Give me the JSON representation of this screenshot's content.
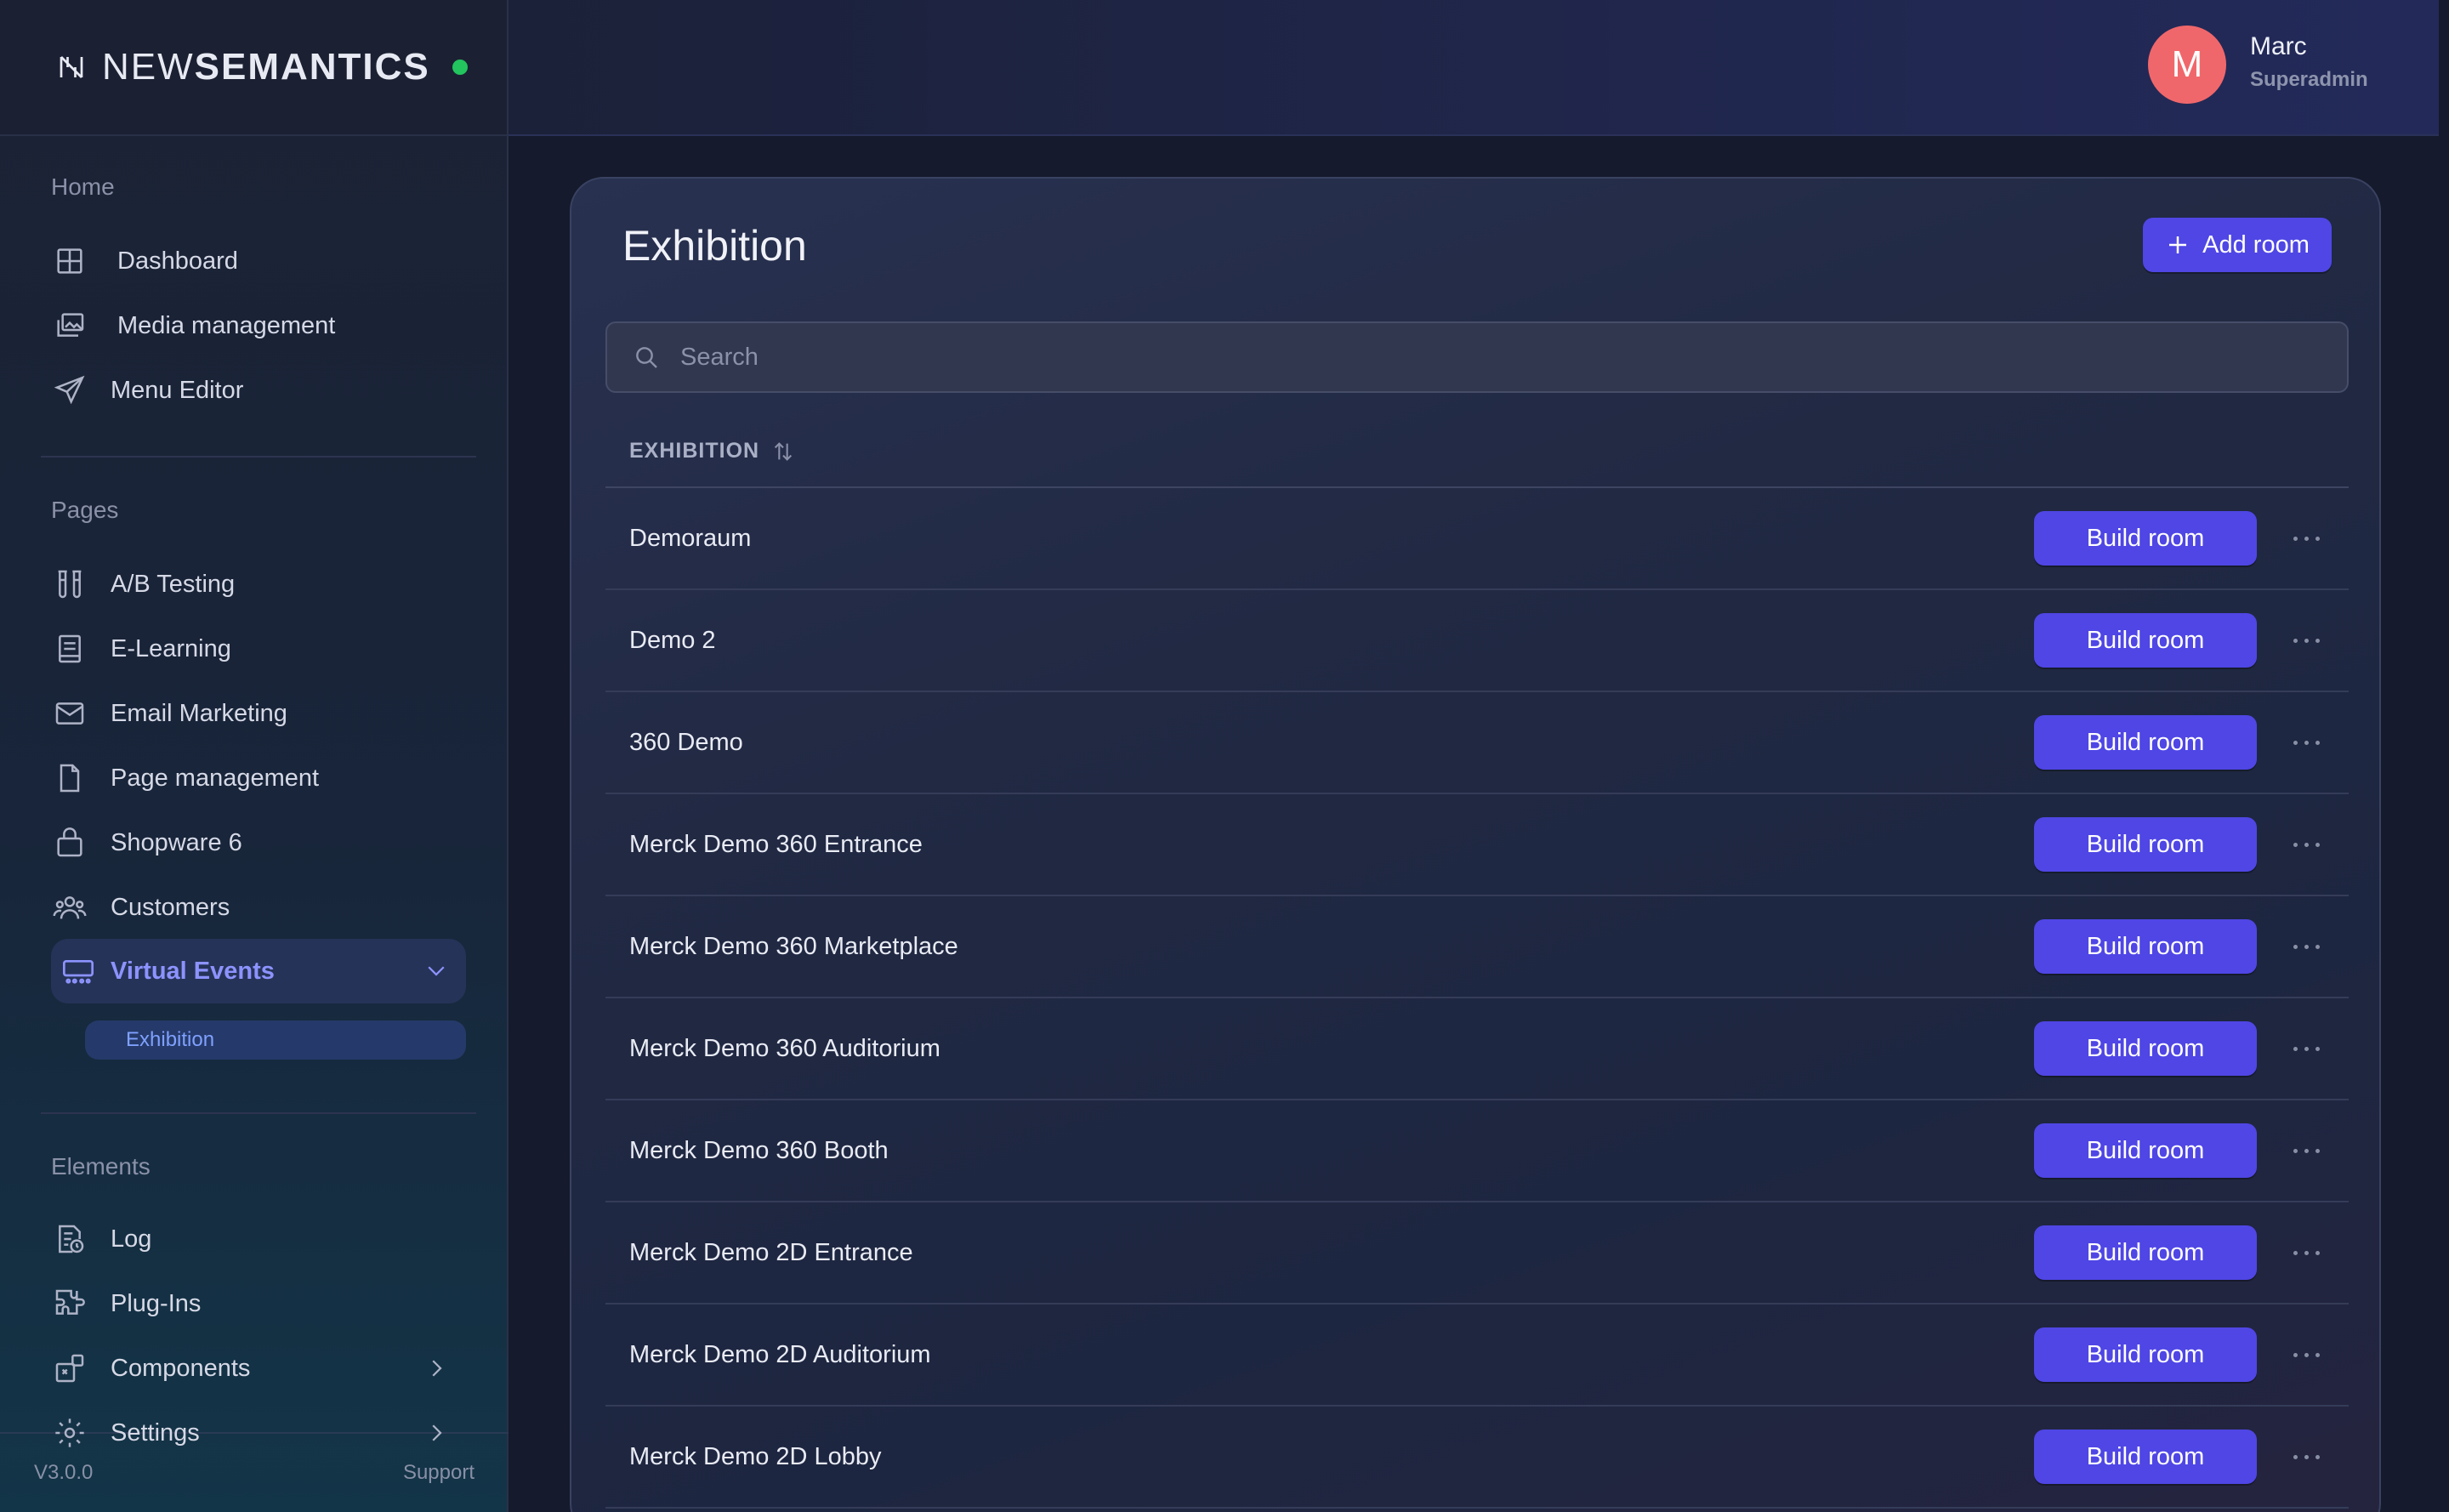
{
  "brand": {
    "name_light": "NEW",
    "name_bold": "SEMANTICS"
  },
  "user": {
    "initial": "M",
    "name": "Marc",
    "role": "Superadmin"
  },
  "sidebar": {
    "sections": {
      "home": "Home",
      "pages": "Pages",
      "elements": "Elements"
    },
    "home_items": [
      {
        "label": "Dashboard",
        "icon": "grid-icon"
      },
      {
        "label": "Media management",
        "icon": "images-icon"
      },
      {
        "label": "Menu Editor",
        "icon": "send-icon"
      }
    ],
    "page_items": [
      {
        "label": "A/B Testing",
        "icon": "test-tubes-icon"
      },
      {
        "label": "E-Learning",
        "icon": "book-icon"
      },
      {
        "label": "Email Marketing",
        "icon": "mail-icon"
      },
      {
        "label": "Page management",
        "icon": "file-icon"
      },
      {
        "label": "Shopware 6",
        "icon": "shopping-bag-icon"
      },
      {
        "label": "Customers",
        "icon": "users-icon"
      },
      {
        "label": "Virtual Events",
        "icon": "events-icon"
      }
    ],
    "sub_item": "Exhibition",
    "element_items": [
      {
        "label": "Log",
        "icon": "log-icon"
      },
      {
        "label": "Plug-Ins",
        "icon": "puzzle-icon"
      },
      {
        "label": "Components",
        "icon": "components-icon"
      },
      {
        "label": "Settings",
        "icon": "gear-icon"
      }
    ],
    "footer": {
      "version": "V3.0.0",
      "support": "Support"
    }
  },
  "main": {
    "title": "Exhibition",
    "add_button": "Add room",
    "search_placeholder": "Search",
    "column_header": "EXHIBITION",
    "build_label": "Build room",
    "rows": [
      "Demoraum",
      "Demo 2",
      "360 Demo",
      "Merck Demo 360 Entrance",
      "Merck Demo 360 Marketplace",
      "Merck Demo 360 Auditorium",
      "Merck Demo 360 Booth",
      "Merck Demo 2D Entrance",
      "Merck Demo 2D Auditorium",
      "Merck Demo 2D Lobby"
    ]
  },
  "colors": {
    "accent": "#4f46e5",
    "active_nav_text": "#8c93ff",
    "status_online": "#22c55e",
    "avatar_bg": "#f0676b"
  }
}
